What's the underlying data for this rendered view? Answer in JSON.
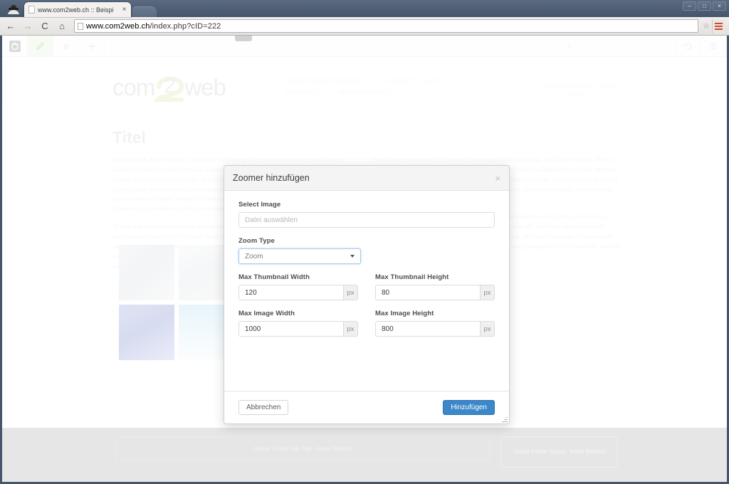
{
  "browser": {
    "tab": {
      "title": "www.com2web.ch :: Beispi",
      "close_label": "×"
    },
    "window_controls": {
      "minimize": "–",
      "maximize": "□",
      "close": "×"
    },
    "nav": {
      "back": "←",
      "forward": "→",
      "reload": "C",
      "home": "⌂"
    },
    "omnibox": {
      "host": "www.com2web.ch",
      "rest": "/index.php?cID=222",
      "star": "☆"
    }
  },
  "cms_bar": {
    "logo_label": "com2web-logo-icon",
    "edit_label": "✎",
    "settings_label": "⚙",
    "add_label": "+",
    "search": {
      "icon": "⌕",
      "value": "",
      "placeholder": ""
    },
    "right_buttons": [
      "undo-icon",
      "list-icon"
    ]
  },
  "site": {
    "logo": {
      "part1": "com",
      "part2": "2",
      "part3": "web"
    },
    "nav_items": [
      {
        "label": "DIENSTLEISTUNGEN"
      },
      {
        "label": "SO SIEHT'S AUS"
      },
      {
        "label": "KONTAKT"
      },
      {
        "label": "BEISPIELSEITE"
      }
    ],
    "header_search_placeholder": "Global Header Search - leerer Bereich",
    "page_title": "Titel",
    "paragraphs_left": [
      "Lorem ipsum dolor sit amet, consetetur sadipscing elitr, sed diam nonumy eirmod tempor invidunt ut labore et dolore magna aliquyam erat, sed diam voluptua. At vero eos et accusam et justo duo dolores et ea rebum. Stet clita kasd gubergren, no sea takimata sanctus est Lorem ipsum dolor sit amet. Lorem ipsum dolor sit amet, consetetur sadipscing elitr, sed diam nonumy eirmod tempor invidunt ut labore et dolore magna aliquyam erat, sed diam voluptua. At vero eos et accusam et justo duo dolores et ea rebum. Stet clita kasd",
      "At vero eos et accusam et justo duo dolores et ea rebum. Stet clita kasd gubergren, no sea takimata sanctus est Lorem ipsum dolor sit amet. Lorem ipsum dolor sit amet, consetetur sadipscing elitr, sed diam nonumy eirmod tempor invidunt ut labore et dolore magna aliquyam erat, sed diam voluptua. At vero eos et accusam et justo duo dolores et ea rebum. Stet clita kasd gubergren, no sea takimata sanctus est Lorem ipsum dolor sit amet."
    ],
    "paragraphs_right": [
      "eirmod tempor invidunt ut labore et dolore magna aliquyam erat, sed diam voluptua. At vero eos et accusam et justo duo dolores et ea rebum. Stet clita kasd gubergren, no sea takimata sanctus est Lorem ipsum dolor sit amet, consetetur sadipscing elitr, sed diam nonumy eirmod tempor invidunt ut labore et dolore magna aliquyam erat, sed diam voluptua. At vero eos et accusam et justo duo",
      "et ea rebum. Stet clita kasd gubergren, no sea takimata sanctus est Lorem ipsum dolor sit amet. Lorem ipsum dolor sit amet, consetetur sadipscing elitr, sed diam nonumy eirmod tempor invidunt ut labore et dolore magna aliquyam erat, sed diam voluptua. At vero eos et accusam et justo duo dolores et ea rebum. Stet clita kasd gubergren, no sea takimata sanctus est Lorem ipsum dolor sit amet."
    ],
    "gallery": [
      {
        "name": "thumbnail-desktop-monitor"
      },
      {
        "name": "thumbnail-laptop-screen"
      },
      {
        "name": "thumbnail-starfield"
      },
      {
        "name": "thumbnail-snow-landscape"
      }
    ],
    "footer": {
      "site_title_block": "Global Footer Site Title - leerer Bereich",
      "social_block": "Global Footer Social - leerer Bereich"
    }
  },
  "modal": {
    "title": "Zoomer hinzufügen",
    "close_label": "×",
    "fields": {
      "select_image": {
        "label": "Select Image",
        "value": "",
        "placeholder": "Datei auswählen"
      },
      "zoom_type": {
        "label": "Zoom Type",
        "value": "Zoom",
        "options": [
          "Zoom"
        ]
      },
      "max_thumbnail_width": {
        "label": "Max Thumbnail Width",
        "value": "120",
        "unit": "px"
      },
      "max_thumbnail_height": {
        "label": "Max Thumbnail Height",
        "value": "80",
        "unit": "px"
      },
      "max_image_width": {
        "label": "Max Image Width",
        "value": "1000",
        "unit": "px"
      },
      "max_image_height": {
        "label": "Max Image Height",
        "value": "800",
        "unit": "px"
      }
    },
    "buttons": {
      "cancel": "Abbrechen",
      "submit": "Hinzufügen"
    },
    "accent_color": "#3b87c9"
  }
}
